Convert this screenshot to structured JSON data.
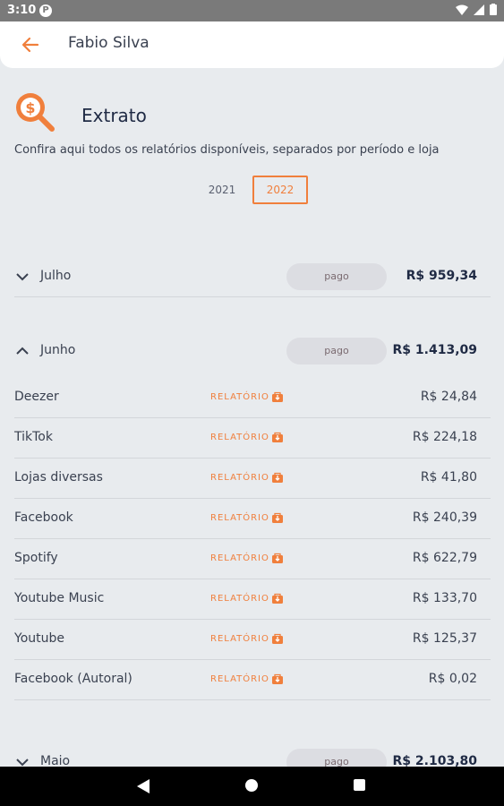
{
  "status_bar": {
    "time": "3:10",
    "notification_icon": "P"
  },
  "app_bar": {
    "title": "Fabio Silva",
    "back_icon": "arrow-left-icon"
  },
  "section": {
    "title": "Extrato",
    "description": "Confira aqui todos os relatórios disponíveis, separados por período e loja",
    "icon": "money-search-icon"
  },
  "years": {
    "items": [
      "2021",
      "2022"
    ],
    "selected": "2022"
  },
  "months": [
    {
      "name": "Julho",
      "status": "pago",
      "total": "R$ 959,34",
      "expanded": false
    },
    {
      "name": "Junho",
      "status": "pago",
      "total": "R$ 1.413,09",
      "expanded": true,
      "reports": [
        {
          "store": "Deezer",
          "link": "RELATÓRIO",
          "amount": "R$ 24,84"
        },
        {
          "store": "TikTok",
          "link": "RELATÓRIO",
          "amount": "R$ 224,18"
        },
        {
          "store": "Lojas diversas",
          "link": "RELATÓRIO",
          "amount": "R$ 41,80"
        },
        {
          "store": "Facebook",
          "link": "RELATÓRIO",
          "amount": "R$ 240,39"
        },
        {
          "store": "Spotify",
          "link": "RELATÓRIO",
          "amount": "R$ 622,79"
        },
        {
          "store": "Youtube Music",
          "link": "RELATÓRIO",
          "amount": "R$ 133,70"
        },
        {
          "store": "Youtube",
          "link": "RELATÓRIO",
          "amount": "R$ 125,37"
        },
        {
          "store": "Facebook (Autoral)",
          "link": "RELATÓRIO",
          "amount": "R$ 0,02"
        }
      ]
    },
    {
      "name": "Maio",
      "status": "pago",
      "total": "R$ 2.103,80",
      "expanded": false
    }
  ],
  "colors": {
    "accent": "#f07f3c",
    "text_dark": "#1f2a44",
    "background": "#e8ebee"
  }
}
